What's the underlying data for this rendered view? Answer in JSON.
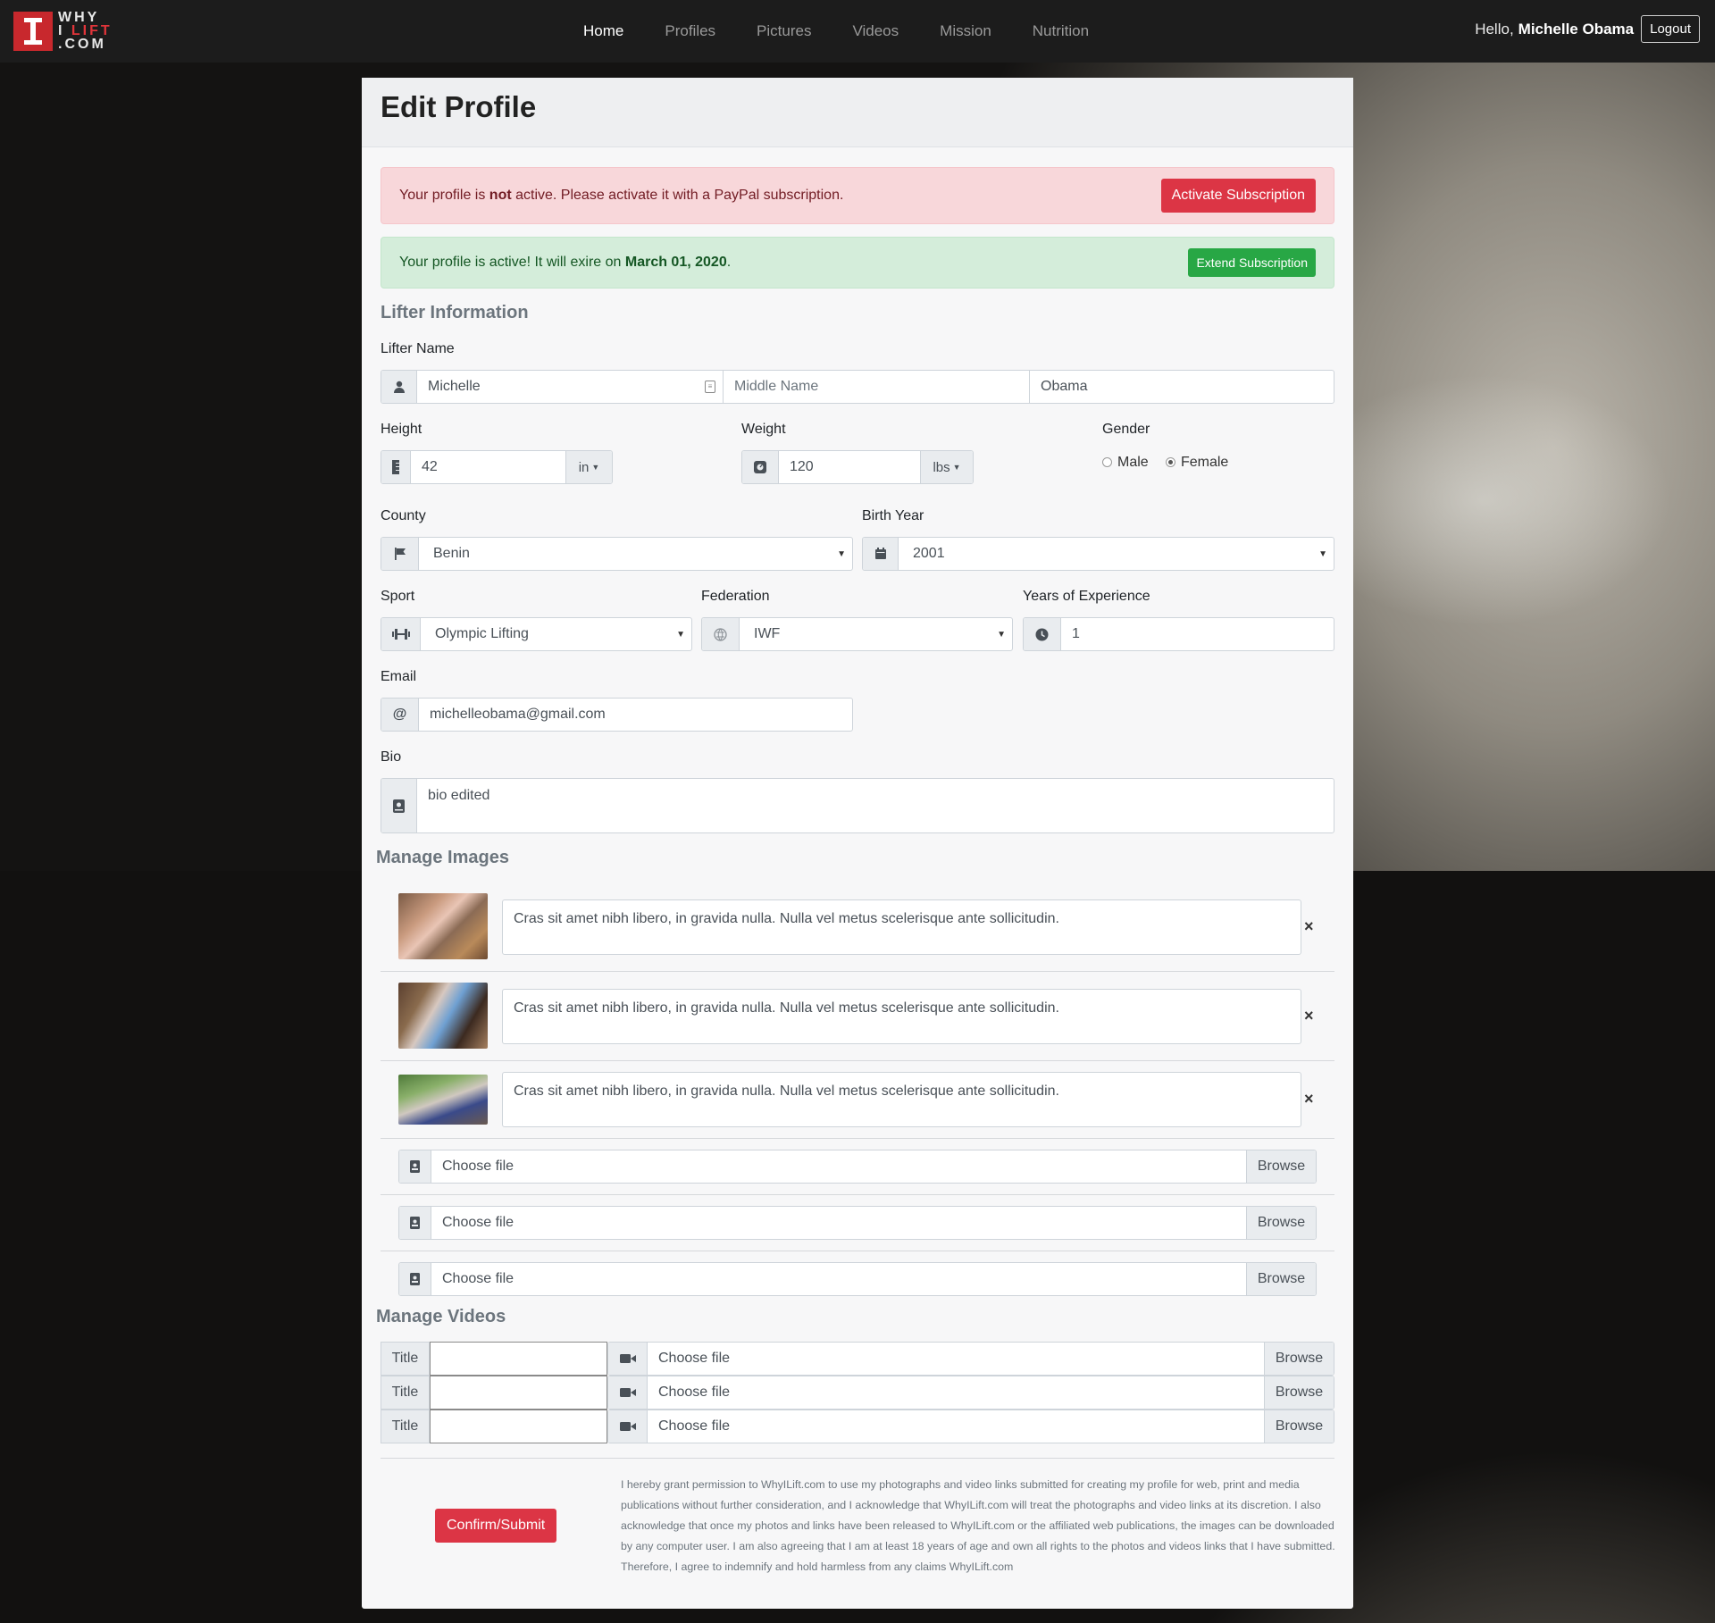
{
  "nav": {
    "logo": {
      "line1": "WHY",
      "line2a": "I ",
      "line2b": "LIFT",
      "line3": ".COM"
    },
    "links": [
      "Home",
      "Profiles",
      "Pictures",
      "Videos",
      "Mission",
      "Nutrition"
    ],
    "greeting": "Hello,",
    "user_name": "Michelle Obama",
    "logout": "Logout"
  },
  "page_title": "Edit Profile",
  "alert_inactive": {
    "pre": "Your profile is ",
    "bold": "not",
    "post": " active. Please activate it with a PayPal subscription.",
    "button": "Activate Subscription"
  },
  "alert_active": {
    "pre": "Your profile is active! It will exire on ",
    "bold": "March 01, 2020",
    "post": ".",
    "button": "Extend Subscription"
  },
  "lifter": {
    "section": "Lifter Information",
    "name_label": "Lifter Name",
    "first_name": "Michelle",
    "middle_placeholder": "Middle Name",
    "last_name": "Obama",
    "height_label": "Height",
    "height_value": "42",
    "height_unit": "in",
    "weight_label": "Weight",
    "weight_value": "120",
    "weight_unit": "lbs",
    "gender_label": "Gender",
    "gender_options": [
      "Male",
      "Female"
    ],
    "gender_selected": "Female",
    "country_label": "County",
    "country_value": "Benin",
    "birth_label": "Birth Year",
    "birth_value": "2001",
    "sport_label": "Sport",
    "sport_value": "Olympic Lifting",
    "federation_label": "Federation",
    "federation_value": "IWF",
    "experience_label": "Years of Experience",
    "experience_value": "1",
    "email_label": "Email",
    "email_value": "michelleobama@gmail.com",
    "email_addon": "@",
    "bio_label": "Bio",
    "bio_value": "bio edited"
  },
  "images": {
    "section": "Manage Images",
    "captions": [
      "Cras sit amet nibh libero, in gravida nulla. Nulla vel metus scelerisque ante sollicitudin.",
      "Cras sit amet nibh libero, in gravida nulla. Nulla vel metus scelerisque ante sollicitudin.",
      "Cras sit amet nibh libero, in gravida nulla. Nulla vel metus scelerisque ante sollicitudin."
    ],
    "remove": "×",
    "file_placeholder": "Choose file",
    "browse": "Browse"
  },
  "videos": {
    "section": "Manage Videos",
    "title_addon": "Title",
    "file_placeholder": "Choose file",
    "browse": "Browse"
  },
  "submit": "Confirm/Submit",
  "disclaimer": "I hereby grant permission to WhyILift.com to use my photographs and video links submitted for creating my profile for web, print and media publications without further consideration, and I acknowledge that WhyILift.com will treat the photographs and video links at its discretion. I also acknowledge that once my photos and links have been released to WhyILift.com or the affiliated web publications, the images can be downloaded by any computer user. I am also agreeing that I am at least 18 years of age and own all rights to the photos and videos links that I have submitted. Therefore, I agree to indemnify and hold harmless from any claims WhyILift.com",
  "colors": {
    "accent_red": "#dc3545",
    "success_green": "#28a745",
    "navbar": "#1c1c1c"
  }
}
